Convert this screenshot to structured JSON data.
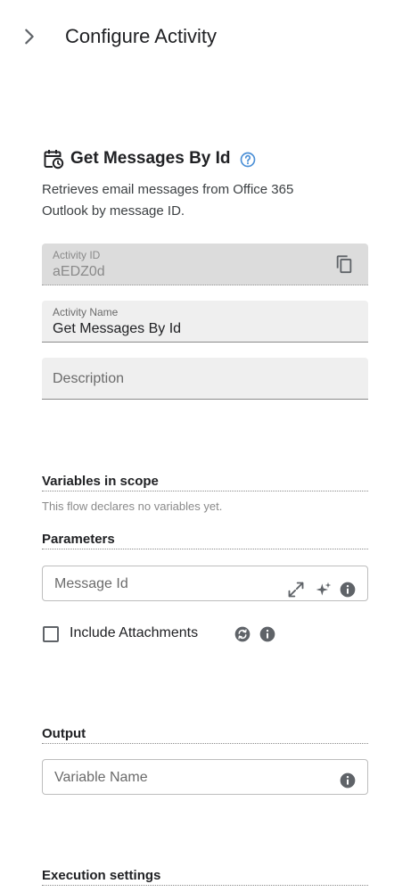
{
  "header": {
    "title": "Configure Activity",
    "collapse_icon": "chevron-right-icon"
  },
  "activity": {
    "title": "Get Messages By Id",
    "icon": "calendar-clock-icon",
    "help_icon": "help-circle-icon",
    "description": "Retrieves email messages from Office 365 Outlook by message ID."
  },
  "fields": {
    "activity_id": {
      "label": "Activity ID",
      "value": "aEDZ0d",
      "copy_icon": "copy-icon"
    },
    "activity_name": {
      "label": "Activity Name",
      "value": "Get Messages By Id"
    },
    "description": {
      "placeholder": "Description"
    }
  },
  "variables": {
    "heading": "Variables in scope",
    "note": "This flow declares no variables yet."
  },
  "parameters": {
    "heading": "Parameters",
    "message_id": {
      "placeholder": "Message Id"
    },
    "include_attachments": {
      "label": "Include Attachments",
      "checked": false
    }
  },
  "output": {
    "heading": "Output",
    "variable_name": {
      "placeholder": "Variable Name"
    }
  },
  "execution": {
    "heading": "Execution settings"
  },
  "colors": {
    "accent": "#4a8fd6",
    "icon_gray": "#5f6368",
    "field_bg": "#efefef",
    "disabled_bg": "#dcdcdc"
  }
}
